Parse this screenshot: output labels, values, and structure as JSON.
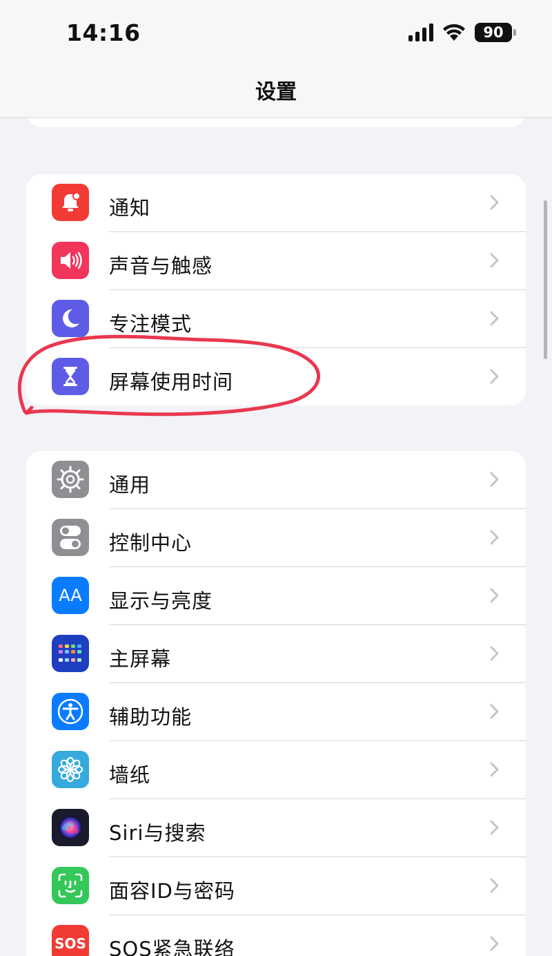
{
  "status_bar": {
    "time": "14:16",
    "battery": "90",
    "icons": [
      "cellular-signal-icon",
      "wifi-icon",
      "battery-icon"
    ]
  },
  "nav": {
    "title": "设置"
  },
  "groups": [
    {
      "items": [
        {
          "label": "通知",
          "icon": "notification-bell-icon",
          "color": "#f23a35"
        },
        {
          "label": "声音与触感",
          "icon": "speaker-icon",
          "color": "#f2355a"
        },
        {
          "label": "专注模式",
          "icon": "moon-icon",
          "color": "#5e5ce6"
        },
        {
          "label": "屏幕使用时间",
          "icon": "hourglass-icon",
          "color": "#5e5ce6"
        }
      ]
    },
    {
      "items": [
        {
          "label": "通用",
          "icon": "gear-icon",
          "color": "#8e8e93"
        },
        {
          "label": "控制中心",
          "icon": "toggles-icon",
          "color": "#8e8e93"
        },
        {
          "label": "显示与亮度",
          "icon": "text-size-icon",
          "icon_text": "AA",
          "color": "#0a7cff"
        },
        {
          "label": "主屏幕",
          "icon": "home-screen-grid-icon",
          "color": "#1f3fc1"
        },
        {
          "label": "辅助功能",
          "icon": "accessibility-icon",
          "color": "#0a7cff"
        },
        {
          "label": "墙纸",
          "icon": "flower-icon",
          "color": "#36aadc"
        },
        {
          "label": "Siri与搜索",
          "icon": "siri-icon",
          "color": "#1b1b2e"
        },
        {
          "label": "面容ID与密码",
          "icon": "face-id-icon",
          "color": "#34c759"
        },
        {
          "label": "SOS紧急联络",
          "icon": "sos-icon",
          "icon_text": "SOS",
          "color": "#f23a35"
        }
      ]
    }
  ],
  "annotation": {
    "highlighted_item": "屏幕使用时间",
    "stroke_color": "#e8384f"
  }
}
